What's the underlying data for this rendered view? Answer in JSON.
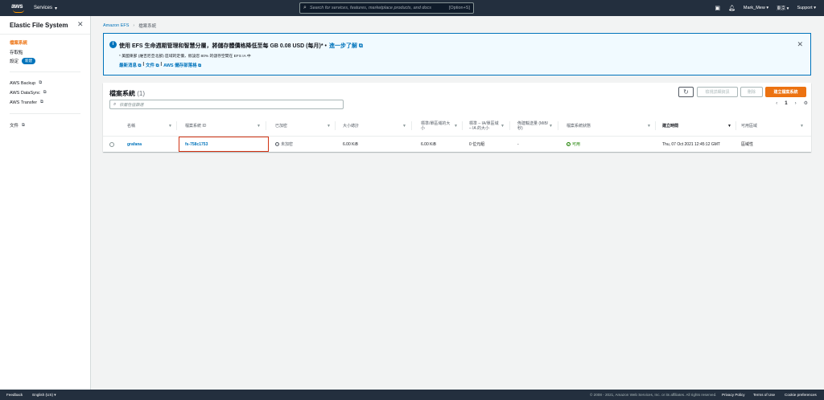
{
  "topnav": {
    "logo_text": "aws",
    "services_label": "Services",
    "search_placeholder": "Search for services, features, marketplace products, and docs",
    "search_shortcut": "[Option+S]",
    "user": "Mark_Mew",
    "region": "東京",
    "support": "Support",
    "brand_color": "#ff9900"
  },
  "sidebar": {
    "title": "Elastic File System",
    "items": [
      {
        "label": "檔案系統",
        "active": true
      },
      {
        "label": "存取點"
      },
      {
        "label": "設定",
        "badge": "新建"
      }
    ],
    "external": [
      {
        "label": "AWS Backup"
      },
      {
        "label": "AWS DataSync"
      },
      {
        "label": "AWS Transfer"
      }
    ],
    "docs": {
      "label": "文件"
    }
  },
  "breadcrumb": {
    "root": "Amazon EFS",
    "current": "檔案系統"
  },
  "banner": {
    "title": "使用 EFS 生命週期管理和智慧分層，將儲存體價格降低至每 GB 0.08 USD (每月)* •",
    "learn_more": "進一步了解",
    "description": "* 美國東部 (維吉尼亞北部) 區域的定價，假設您 80% 的儲存空間在 EFS IA 中",
    "link_news": "最新消息",
    "link_docs": "文件",
    "link_pricing": "AWS 儲存部落格",
    "separator": "|"
  },
  "panel": {
    "title": "檔案系統",
    "count": "(1)",
    "btn_details": "檢視詳細資訊",
    "btn_delete": "刪除",
    "btn_create": "建立檔案系統",
    "filter_placeholder": "依屬性值篩選",
    "page": "1",
    "columns": [
      "名稱",
      "檔案系統 ID",
      "已加密",
      "大小總計",
      "標準/單區域的大小",
      "標準 – IA/單區域 – IA 的大小",
      "佈建輸送量 (MiB/秒)",
      "檔案系統狀態",
      "建立時間",
      "可用區域"
    ],
    "rows": [
      {
        "name": "grafana",
        "id": "fs-758c1753",
        "encrypted": "未加密",
        "total": "6.00 KiB",
        "standard": "6.00 KiB",
        "ia": "0 位元組",
        "throughput": "-",
        "state": "可用",
        "created": "Thu, 07 Oct 2021 12:45:12 GMT",
        "az": "區域性"
      }
    ]
  },
  "footer": {
    "feedback": "Feedback",
    "language": "English (US)",
    "copyright": "© 2008 - 2021, Amazon Web Services, Inc. or its affiliates. All rights reserved.",
    "privacy": "Privacy Policy",
    "terms": "Terms of Use",
    "cookie": "Cookie preferences"
  }
}
